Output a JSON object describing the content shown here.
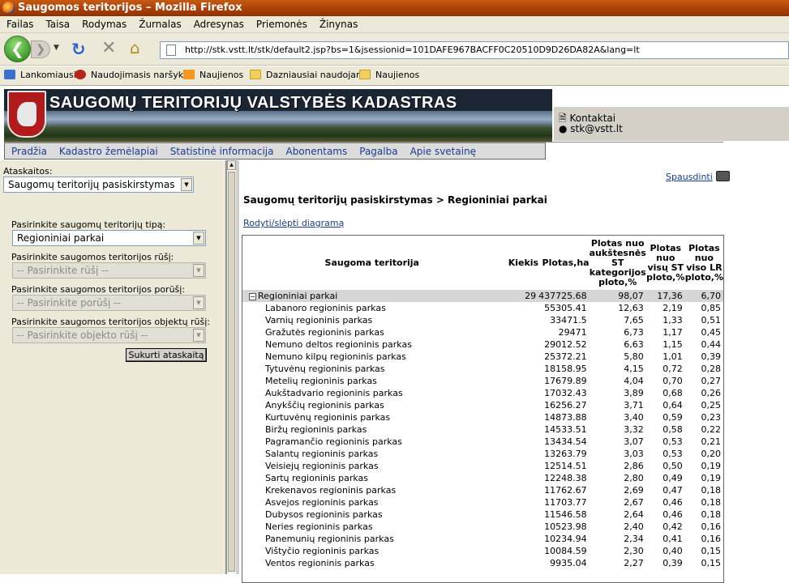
{
  "window": {
    "title": "Saugomos teritorijos – Mozilla Firefox"
  },
  "menu": [
    "Failas",
    "Taisa",
    "Rodymas",
    "Žurnalas",
    "Adresynas",
    "Priemonės",
    "Žinynas"
  ],
  "toolbar": {
    "url": "http://stk.vstt.lt/stk/default2.jsp?bs=1&jsessionid=101DAFE967BACFF0C20510D9D26DA82A&lang=lt"
  },
  "bookmarks": [
    "Lankomiausi",
    "Naudojimasis naršykle",
    "Naujienos",
    "Dazniausiai naudojami",
    "Naujienos"
  ],
  "site": {
    "banner_title": "SAUGOMŲ TERITORIJŲ VALSTYBĖS KADASTRAS",
    "contact_title": "Kontaktai",
    "contact_email": "stk@vstt.lt",
    "nav": [
      "Pradžia",
      "Kadastro žemėlapiai",
      "Statistinė informacija",
      "Abonentams",
      "Pagalba",
      "Apie svetainę"
    ]
  },
  "left": {
    "reports_label": "Ataskaitos:",
    "reports_value": "Saugomų teritorijų pasiskirstymas",
    "type_label": "Pasirinkite saugomų teritorijų tipą:",
    "type_value": "Regioniniai parkai",
    "kind_label": "Pasirinkite saugomos teritorijos rūšį:",
    "kind_value": "-- Pasirinkite rūšį --",
    "subkind_label": "Pasirinkite saugomos teritorijos porūšį:",
    "subkind_value": "-- Pasirinkite porūšį --",
    "object_label": "Pasirinkite saugomos teritorijos objektų rūšį:",
    "object_value": "-- Pasirinkite objekto rūšį --",
    "submit": "Sukurti ataskaitą"
  },
  "report": {
    "print": "Spausdinti",
    "heading": "Saugomų teritorijų pasiskirstymas > Regioniniai parkai",
    "toggle": "Rodyti/slėpti diagramą",
    "columns": {
      "name": "Saugoma teritorija",
      "count": "Kiekis",
      "area": "Plotas,ha",
      "pct_cat": "Plotas nuo aukštesnės ST kategorijos ploto,%",
      "pct_all": "Plotas nuo visų ST ploto,%",
      "pct_lr": "Plotas nuo viso LR ploto,%"
    },
    "group": {
      "name": "Regioniniai parkai",
      "count": "29",
      "area": "437725.68",
      "pct_cat": "98,07",
      "pct_all": "17,36",
      "pct_lr": "6,70"
    },
    "rows": [
      {
        "name": "Labanoro regioninis parkas",
        "area": "55305.41",
        "pct_cat": "12,63",
        "pct_all": "2,19",
        "pct_lr": "0,85"
      },
      {
        "name": "Varnių regioninis parkas",
        "area": "33471.5",
        "pct_cat": "7,65",
        "pct_all": "1,33",
        "pct_lr": "0,51"
      },
      {
        "name": "Gražutės regioninis parkas",
        "area": "29471",
        "pct_cat": "6,73",
        "pct_all": "1,17",
        "pct_lr": "0,45"
      },
      {
        "name": "Nemuno deltos regioninis parkas",
        "area": "29012.52",
        "pct_cat": "6,63",
        "pct_all": "1,15",
        "pct_lr": "0,44"
      },
      {
        "name": "Nemuno kilpų regioninis parkas",
        "area": "25372.21",
        "pct_cat": "5,80",
        "pct_all": "1,01",
        "pct_lr": "0,39"
      },
      {
        "name": "Tytuvėnų regioninis parkas",
        "area": "18158.95",
        "pct_cat": "4,15",
        "pct_all": "0,72",
        "pct_lr": "0,28"
      },
      {
        "name": "Metelių regioninis parkas",
        "area": "17679.89",
        "pct_cat": "4,04",
        "pct_all": "0,70",
        "pct_lr": "0,27"
      },
      {
        "name": "Aukštadvario regioninis parkas",
        "area": "17032.43",
        "pct_cat": "3,89",
        "pct_all": "0,68",
        "pct_lr": "0,26"
      },
      {
        "name": "Anykščių regioninis parkas",
        "area": "16256.27",
        "pct_cat": "3,71",
        "pct_all": "0,64",
        "pct_lr": "0,25"
      },
      {
        "name": "Kurtuvėnų regioninis parkas",
        "area": "14873.88",
        "pct_cat": "3,40",
        "pct_all": "0,59",
        "pct_lr": "0,23"
      },
      {
        "name": "Biržų regioninis parkas",
        "area": "14533.51",
        "pct_cat": "3,32",
        "pct_all": "0,58",
        "pct_lr": "0,22"
      },
      {
        "name": "Pagramančio regioninis parkas",
        "area": "13434.54",
        "pct_cat": "3,07",
        "pct_all": "0,53",
        "pct_lr": "0,21"
      },
      {
        "name": "Salantų regioninis parkas",
        "area": "13263.79",
        "pct_cat": "3,03",
        "pct_all": "0,53",
        "pct_lr": "0,20"
      },
      {
        "name": "Veisiejų regioninis parkas",
        "area": "12514.51",
        "pct_cat": "2,86",
        "pct_all": "0,50",
        "pct_lr": "0,19"
      },
      {
        "name": "Sartų regioninis parkas",
        "area": "12248.38",
        "pct_cat": "2,80",
        "pct_all": "0,49",
        "pct_lr": "0,19"
      },
      {
        "name": "Krekenavos regioninis parkas",
        "area": "11762.67",
        "pct_cat": "2,69",
        "pct_all": "0,47",
        "pct_lr": "0,18"
      },
      {
        "name": "Asvejos regioninis parkas",
        "area": "11703.77",
        "pct_cat": "2,67",
        "pct_all": "0,46",
        "pct_lr": "0,18"
      },
      {
        "name": "Dubysos regioninis parkas",
        "area": "11546.58",
        "pct_cat": "2,64",
        "pct_all": "0,46",
        "pct_lr": "0,18"
      },
      {
        "name": "Neries regioninis parkas",
        "area": "10523.98",
        "pct_cat": "2,40",
        "pct_all": "0,42",
        "pct_lr": "0,16"
      },
      {
        "name": "Panemunių regioninis parkas",
        "area": "10234.94",
        "pct_cat": "2,34",
        "pct_all": "0,41",
        "pct_lr": "0,16"
      },
      {
        "name": "Vištyčio regioninis parkas",
        "area": "10084.59",
        "pct_cat": "2,30",
        "pct_all": "0,40",
        "pct_lr": "0,15"
      },
      {
        "name": "Ventos regioninis parkas",
        "area": "9935.04",
        "pct_cat": "2,27",
        "pct_all": "0,39",
        "pct_lr": "0,15"
      }
    ]
  }
}
